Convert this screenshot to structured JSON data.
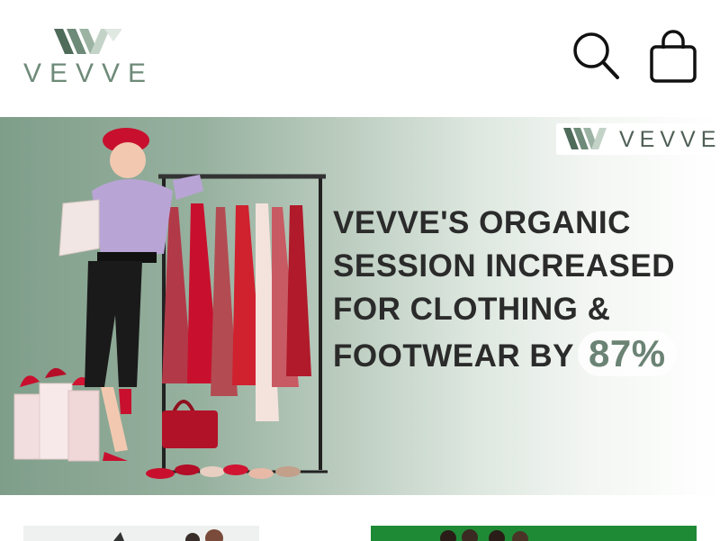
{
  "header": {
    "logo_text": "VEVVE",
    "icons": {
      "search": "search-icon",
      "bag": "shopping-bag-icon"
    }
  },
  "hero": {
    "logo_text": "VEVVE",
    "headline": [
      "VEVVE'S ORGANIC",
      "SESSION INCREASED",
      "FOR CLOTHING &",
      "FOOTWEAR BY"
    ],
    "highlight": "87%"
  },
  "colors": {
    "brand_green": "#6e8a78",
    "hero_gradient_start": "#7f9e8a",
    "headline": "#2b2b2b",
    "dress_red": "#c8102e"
  }
}
